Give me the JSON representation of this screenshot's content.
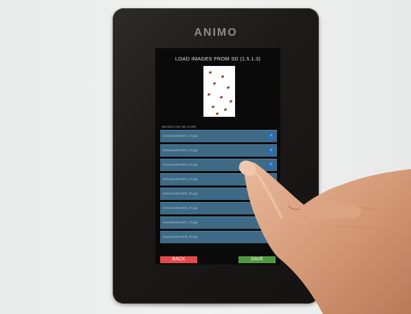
{
  "device": {
    "brand": "ANIMO",
    "screen_title": "LOAD IMAGES FROM SD (1.5.1.3)",
    "section_label": "IMAGES ON SD CARD",
    "files": [
      {
        "name": "Sxxxxxxxxxxx001_72.jpg",
        "checked": true
      },
      {
        "name": "Sxxxxxxxxxxx002_72.jpg",
        "checked": true
      },
      {
        "name": "Sxxxxxxxxxxx003_72.jpg",
        "checked": true
      },
      {
        "name": "Sxxxxxxxxxxx004_72.jpg",
        "checked": false
      },
      {
        "name": "Sxxxxxxxxxxx005_72.jpg",
        "checked": false
      },
      {
        "name": "Sxxxxxxxxxxx006_72.jpg",
        "checked": false
      },
      {
        "name": "Sxxxxxxxxxxx007_72.jpg",
        "checked": false
      },
      {
        "name": "Sxxxxxxxxxxx008_72.jpg",
        "checked": false
      }
    ],
    "back_label": "BACK",
    "save_label": "SAVE",
    "check_icon": "check-icon"
  },
  "colors": {
    "row": "#3f6a86",
    "check_on": "#1f6fd1",
    "back": "#e5494e",
    "save": "#4f9a3f",
    "preview_dots": "#8b4a2b"
  }
}
